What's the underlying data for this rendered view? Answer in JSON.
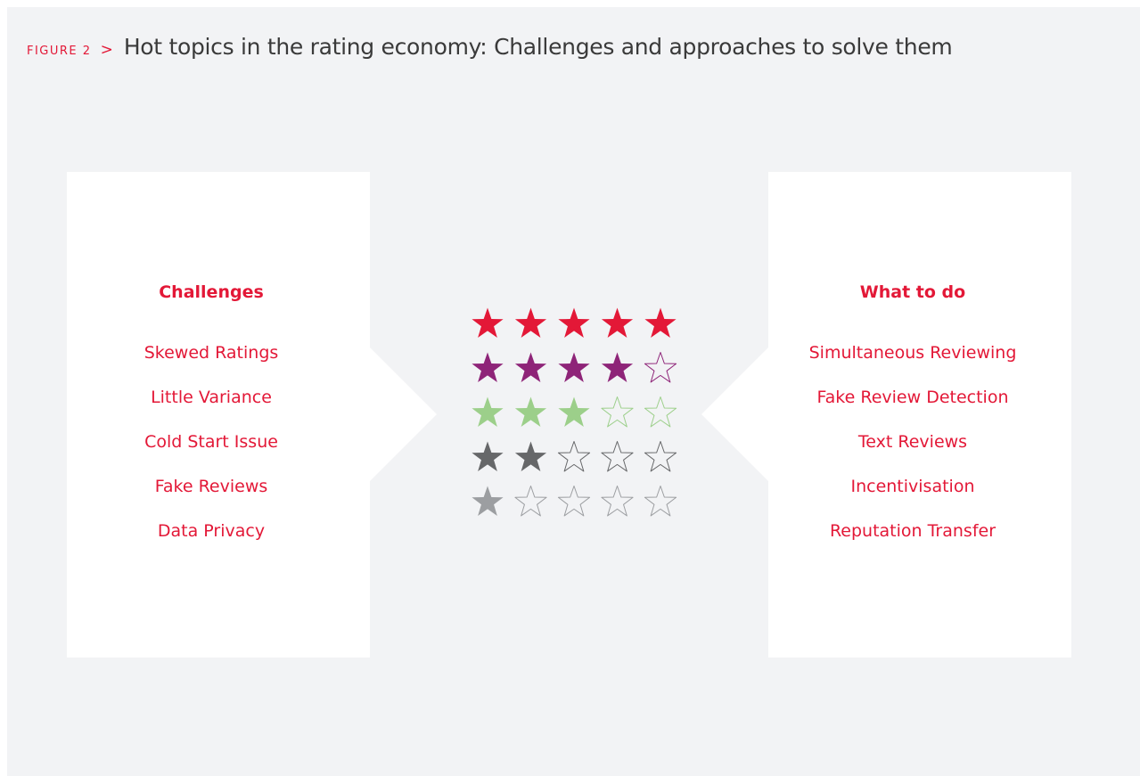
{
  "header": {
    "figure_label": "FIGURE 2",
    "separator": ">",
    "title": "Hot topics in the rating economy: Challenges and approaches to solve them"
  },
  "left_panel": {
    "heading": "Challenges",
    "items": [
      "Skewed Ratings",
      "Little Variance",
      "Cold Start Issue",
      "Fake Reviews",
      "Data Privacy"
    ]
  },
  "right_panel": {
    "heading": "What to do",
    "items": [
      "Simultaneous Reviewing",
      "Fake Review Detection",
      "Text Reviews",
      "Incentivisation",
      "Reputation Transfer"
    ]
  },
  "star_ratings": {
    "max_stars": 5,
    "rows": [
      {
        "rating": 5,
        "color": "#e31837"
      },
      {
        "rating": 4,
        "color": "#8e2478"
      },
      {
        "rating": 3,
        "color": "#9ccf8a"
      },
      {
        "rating": 2,
        "color": "#666769"
      },
      {
        "rating": 1,
        "color": "#9c9ea1"
      }
    ]
  },
  "colors": {
    "accent": "#e31837",
    "background": "#f2f3f5",
    "panel": "#ffffff",
    "title_text": "#3a3a3a"
  }
}
